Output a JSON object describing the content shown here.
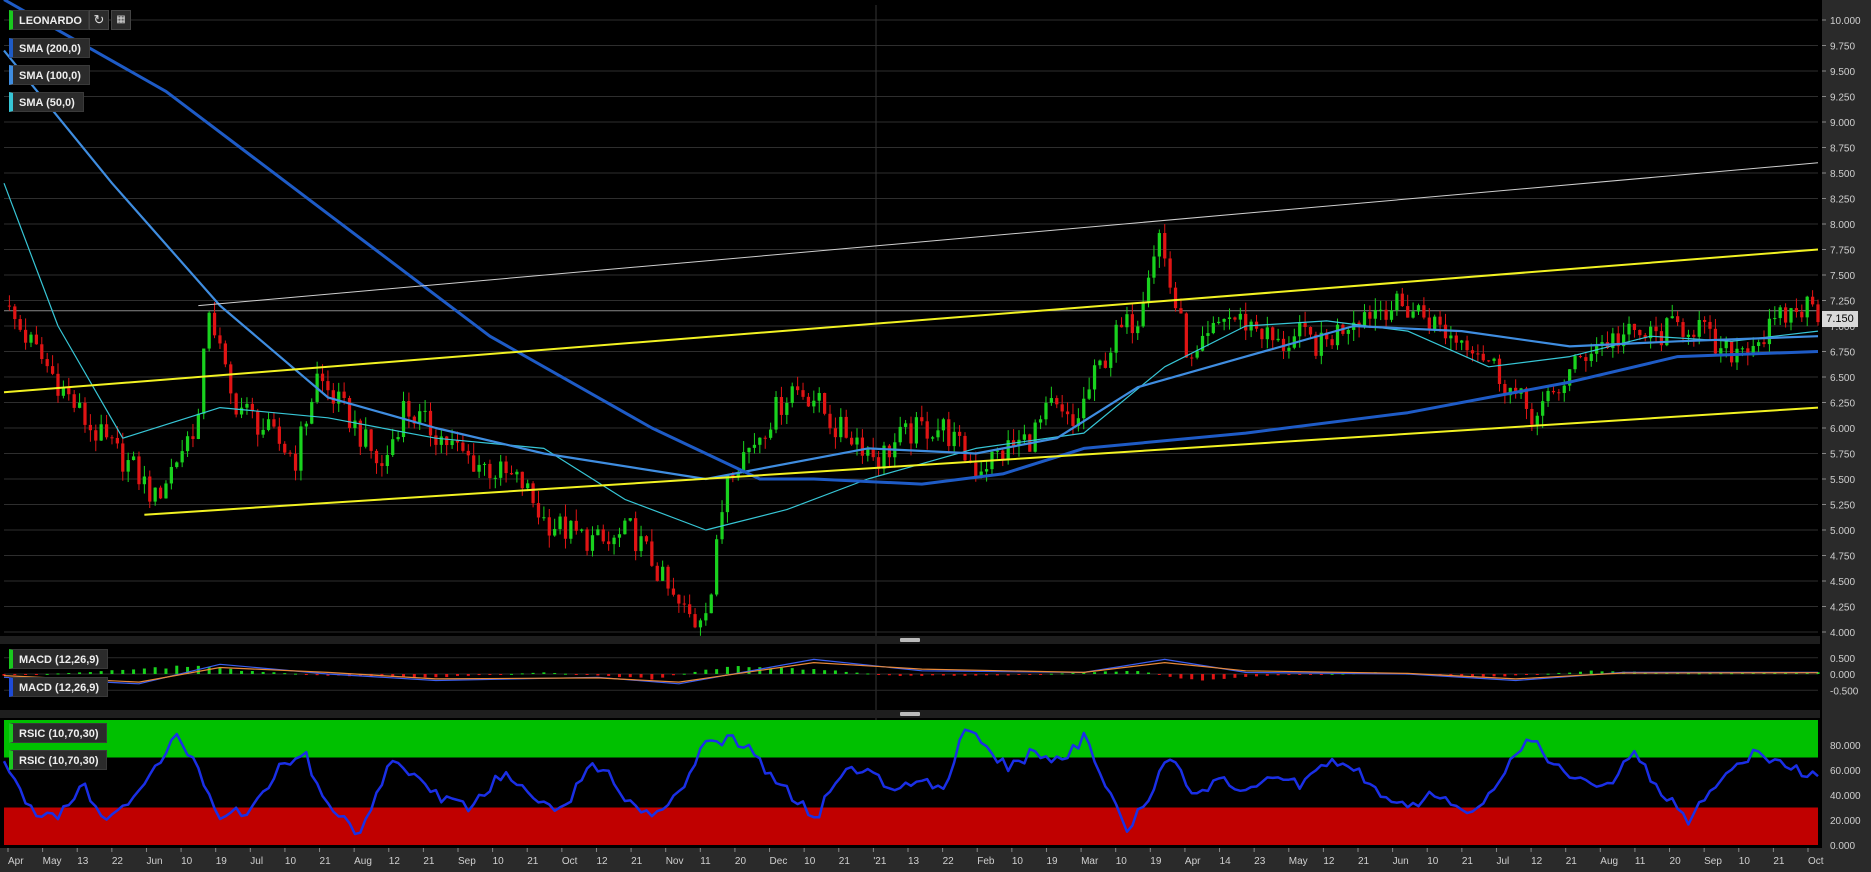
{
  "toolbar": {
    "symbol": "LEONARDO",
    "refresh_icon": "refresh-icon",
    "menu_icon": "calculator-icon"
  },
  "indicators": {
    "sma200": {
      "label": "SMA (200,0)",
      "color": "#1e5bc6"
    },
    "sma100": {
      "label": "SMA (100,0)",
      "color": "#3f8de0"
    },
    "sma50": {
      "label": "SMA (50,0)",
      "color": "#37c6d6"
    },
    "macd1": {
      "label": "MACD (12,26,9)",
      "color": "#19c81e"
    },
    "macd2": {
      "label": "MACD (12,26,9)",
      "color": "#1e4bd6"
    },
    "rsic1": {
      "label": "RSIC (10,70,30)",
      "color": "#19c81e"
    },
    "rsic2": {
      "label": "RSIC (10,70,30)",
      "color": "#19c81e"
    }
  },
  "last_price": "7.150",
  "colors": {
    "up": "#19d21e",
    "down": "#e01414",
    "trend_yellow": "#f2f222",
    "trend_white": "#cfcfcf",
    "rsi_line": "#1a2fe6",
    "rsi_overbought": "#00c000",
    "rsi_oversold": "#c00000"
  },
  "chart_data": [
    {
      "type": "candlestick",
      "panel": "price",
      "y_ticks": [
        "10.000",
        "9.750",
        "9.500",
        "9.250",
        "9.000",
        "8.750",
        "8.500",
        "8.250",
        "8.000",
        "7.750",
        "7.500",
        "7.250",
        "7.000",
        "6.750",
        "6.500",
        "6.250",
        "6.000",
        "5.750",
        "5.500",
        "5.250",
        "5.000",
        "4.750",
        "4.500",
        "4.250",
        "4.000"
      ],
      "ylim": [
        4.0,
        10.0
      ],
      "x_ticks": [
        "Apr",
        "May",
        "13",
        "22",
        "Jun",
        "10",
        "19",
        "Jul",
        "10",
        "21",
        "Aug",
        "12",
        "21",
        "Sep",
        "10",
        "21",
        "Oct",
        "12",
        "21",
        "Nov",
        "11",
        "20",
        "Dec",
        "10",
        "21",
        "'21",
        "13",
        "22",
        "Feb",
        "10",
        "19",
        "Mar",
        "10",
        "19",
        "Apr",
        "14",
        "23",
        "May",
        "12",
        "21",
        "Jun",
        "10",
        "21",
        "Jul",
        "12",
        "21",
        "Aug",
        "11",
        "20",
        "Sep",
        "10",
        "21",
        "Oct"
      ],
      "close_path": [
        [
          0,
          7.2
        ],
        [
          8,
          6.6
        ],
        [
          16,
          6.0
        ],
        [
          24,
          5.6
        ],
        [
          28,
          5.3
        ],
        [
          33,
          5.8
        ],
        [
          36,
          6.1
        ],
        [
          38,
          7.2
        ],
        [
          42,
          6.3
        ],
        [
          48,
          6.0
        ],
        [
          54,
          5.7
        ],
        [
          58,
          6.5
        ],
        [
          64,
          6.1
        ],
        [
          70,
          5.6
        ],
        [
          74,
          6.2
        ],
        [
          80,
          5.95
        ],
        [
          86,
          5.7
        ],
        [
          92,
          5.55
        ],
        [
          96,
          5.45
        ],
        [
          100,
          5.1
        ],
        [
          106,
          4.95
        ],
        [
          112,
          4.85
        ],
        [
          116,
          5.0
        ],
        [
          120,
          4.7
        ],
        [
          124,
          4.3
        ],
        [
          128,
          4.1
        ],
        [
          131,
          4.4
        ],
        [
          134,
          5.6
        ],
        [
          138,
          5.8
        ],
        [
          142,
          6.1
        ],
        [
          146,
          6.4
        ],
        [
          150,
          6.3
        ],
        [
          154,
          6.0
        ],
        [
          158,
          5.9
        ],
        [
          162,
          5.7
        ],
        [
          166,
          5.9
        ],
        [
          170,
          6.0
        ],
        [
          174,
          6.0
        ],
        [
          180,
          5.6
        ],
        [
          186,
          5.8
        ],
        [
          190,
          5.9
        ],
        [
          194,
          6.2
        ],
        [
          198,
          6.0
        ],
        [
          202,
          6.5
        ],
        [
          206,
          6.9
        ],
        [
          210,
          7.1
        ],
        [
          212,
          7.6
        ],
        [
          214,
          7.9
        ],
        [
          216,
          7.4
        ],
        [
          220,
          6.6
        ],
        [
          226,
          7.1
        ],
        [
          232,
          7.0
        ],
        [
          236,
          6.8
        ],
        [
          240,
          6.9
        ],
        [
          244,
          6.8
        ],
        [
          250,
          7.1
        ],
        [
          256,
          7.2
        ],
        [
          262,
          7.15
        ],
        [
          268,
          6.9
        ],
        [
          272,
          6.85
        ],
        [
          276,
          6.6
        ],
        [
          280,
          6.3
        ],
        [
          284,
          6.1
        ],
        [
          288,
          6.4
        ],
        [
          294,
          6.8
        ],
        [
          300,
          6.9
        ],
        [
          306,
          6.9
        ],
        [
          310,
          7.0
        ],
        [
          314,
          7.0
        ],
        [
          318,
          6.7
        ],
        [
          322,
          6.8
        ],
        [
          326,
          6.9
        ],
        [
          330,
          7.1
        ],
        [
          334,
          7.2
        ],
        [
          336,
          7.15
        ]
      ],
      "sma": {
        "sma200": [
          [
            0,
            10.2
          ],
          [
            30,
            9.3
          ],
          [
            60,
            8.1
          ],
          [
            90,
            6.9
          ],
          [
            120,
            6.0
          ],
          [
            140,
            5.5
          ],
          [
            150,
            5.5
          ],
          [
            170,
            5.45
          ],
          [
            185,
            5.55
          ],
          [
            200,
            5.8
          ],
          [
            230,
            5.95
          ],
          [
            260,
            6.15
          ],
          [
            290,
            6.45
          ],
          [
            310,
            6.7
          ],
          [
            336,
            6.75
          ]
        ],
        "sma100": [
          [
            0,
            9.7
          ],
          [
            20,
            8.4
          ],
          [
            40,
            7.2
          ],
          [
            60,
            6.3
          ],
          [
            80,
            6.0
          ],
          [
            100,
            5.75
          ],
          [
            130,
            5.5
          ],
          [
            160,
            5.8
          ],
          [
            180,
            5.75
          ],
          [
            195,
            5.9
          ],
          [
            210,
            6.4
          ],
          [
            230,
            6.7
          ],
          [
            250,
            7.0
          ],
          [
            270,
            6.95
          ],
          [
            290,
            6.8
          ],
          [
            310,
            6.85
          ],
          [
            336,
            6.9
          ]
        ],
        "sma50": [
          [
            0,
            8.4
          ],
          [
            10,
            7.0
          ],
          [
            22,
            5.9
          ],
          [
            40,
            6.2
          ],
          [
            60,
            6.1
          ],
          [
            80,
            5.9
          ],
          [
            100,
            5.8
          ],
          [
            115,
            5.3
          ],
          [
            130,
            5.0
          ],
          [
            145,
            5.2
          ],
          [
            160,
            5.5
          ],
          [
            180,
            5.8
          ],
          [
            200,
            5.95
          ],
          [
            215,
            6.6
          ],
          [
            230,
            7.0
          ],
          [
            245,
            7.05
          ],
          [
            260,
            6.95
          ],
          [
            275,
            6.6
          ],
          [
            290,
            6.7
          ],
          [
            305,
            6.9
          ],
          [
            320,
            6.85
          ],
          [
            336,
            6.95
          ]
        ]
      },
      "trendlines": [
        {
          "color": "yellow",
          "from": [
            0,
            6.35
          ],
          "to": [
            336,
            7.75
          ]
        },
        {
          "color": "yellow",
          "from": [
            26,
            5.15
          ],
          "to": [
            336,
            6.2
          ]
        },
        {
          "color": "white",
          "from": [
            36,
            7.2
          ],
          "to": [
            336,
            8.6
          ]
        }
      ]
    },
    {
      "type": "histogram",
      "panel": "macd",
      "y_ticks": [
        "0.500",
        "0.000",
        "-0.500"
      ],
      "ylim": [
        -0.8,
        0.8
      ],
      "histogram": [
        [
          0,
          -0.05
        ],
        [
          15,
          0.05
        ],
        [
          35,
          0.25
        ],
        [
          45,
          0.1
        ],
        [
          60,
          -0.05
        ],
        [
          80,
          -0.1
        ],
        [
          100,
          0.05
        ],
        [
          120,
          -0.15
        ],
        [
          135,
          0.25
        ],
        [
          150,
          0.15
        ],
        [
          165,
          -0.05
        ],
        [
          185,
          -0.05
        ],
        [
          200,
          0.05
        ],
        [
          210,
          0.1
        ],
        [
          220,
          -0.2
        ],
        [
          235,
          -0.05
        ],
        [
          255,
          0.05
        ],
        [
          275,
          -0.1
        ],
        [
          295,
          0.1
        ],
        [
          315,
          0.02
        ],
        [
          336,
          0.05
        ]
      ],
      "macd_line": [
        [
          0,
          -0.1
        ],
        [
          25,
          -0.3
        ],
        [
          40,
          0.3
        ],
        [
          60,
          0.0
        ],
        [
          80,
          -0.2
        ],
        [
          110,
          -0.1
        ],
        [
          125,
          -0.3
        ],
        [
          150,
          0.45
        ],
        [
          170,
          0.1
        ],
        [
          200,
          0.05
        ],
        [
          215,
          0.45
        ],
        [
          230,
          0.05
        ],
        [
          260,
          0.0
        ],
        [
          280,
          -0.2
        ],
        [
          300,
          0.05
        ],
        [
          336,
          0.05
        ]
      ],
      "signal_line": [
        [
          0,
          -0.05
        ],
        [
          25,
          -0.25
        ],
        [
          40,
          0.2
        ],
        [
          60,
          0.05
        ],
        [
          80,
          -0.15
        ],
        [
          110,
          -0.12
        ],
        [
          125,
          -0.25
        ],
        [
          150,
          0.35
        ],
        [
          170,
          0.15
        ],
        [
          200,
          0.05
        ],
        [
          215,
          0.35
        ],
        [
          230,
          0.1
        ],
        [
          260,
          0.02
        ],
        [
          280,
          -0.15
        ],
        [
          300,
          0.03
        ],
        [
          336,
          0.04
        ]
      ]
    },
    {
      "type": "line",
      "panel": "rsi",
      "y_ticks": [
        "80.000",
        "60.000",
        "40.000",
        "20.000",
        "0.000"
      ],
      "ylim": [
        0,
        100
      ],
      "bands": {
        "overbought": 70,
        "oversold": 30
      },
      "values": [
        [
          0,
          68
        ],
        [
          5,
          28
        ],
        [
          10,
          25
        ],
        [
          15,
          50
        ],
        [
          18,
          20
        ],
        [
          22,
          28
        ],
        [
          28,
          65
        ],
        [
          32,
          85
        ],
        [
          36,
          60
        ],
        [
          40,
          25
        ],
        [
          46,
          28
        ],
        [
          52,
          68
        ],
        [
          56,
          70
        ],
        [
          60,
          30
        ],
        [
          66,
          10
        ],
        [
          72,
          70
        ],
        [
          76,
          55
        ],
        [
          80,
          40
        ],
        [
          86,
          30
        ],
        [
          92,
          55
        ],
        [
          96,
          48
        ],
        [
          100,
          35
        ],
        [
          104,
          28
        ],
        [
          108,
          65
        ],
        [
          112,
          55
        ],
        [
          116,
          35
        ],
        [
          120,
          25
        ],
        [
          124,
          35
        ],
        [
          130,
          80
        ],
        [
          134,
          85
        ],
        [
          138,
          78
        ],
        [
          142,
          55
        ],
        [
          146,
          40
        ],
        [
          150,
          20
        ],
        [
          156,
          62
        ],
        [
          160,
          58
        ],
        [
          166,
          45
        ],
        [
          170,
          55
        ],
        [
          174,
          45
        ],
        [
          178,
          95
        ],
        [
          182,
          80
        ],
        [
          186,
          60
        ],
        [
          190,
          72
        ],
        [
          196,
          70
        ],
        [
          200,
          85
        ],
        [
          204,
          50
        ],
        [
          208,
          10
        ],
        [
          212,
          38
        ],
        [
          216,
          72
        ],
        [
          220,
          45
        ],
        [
          226,
          50
        ],
        [
          230,
          40
        ],
        [
          236,
          55
        ],
        [
          240,
          48
        ],
        [
          246,
          70
        ],
        [
          250,
          62
        ],
        [
          256,
          35
        ],
        [
          260,
          30
        ],
        [
          266,
          42
        ],
        [
          270,
          25
        ],
        [
          276,
          40
        ],
        [
          282,
          88
        ],
        [
          286,
          70
        ],
        [
          290,
          55
        ],
        [
          296,
          45
        ],
        [
          302,
          72
        ],
        [
          306,
          48
        ],
        [
          312,
          20
        ],
        [
          318,
          55
        ],
        [
          324,
          72
        ],
        [
          330,
          62
        ],
        [
          336,
          58
        ]
      ]
    }
  ]
}
